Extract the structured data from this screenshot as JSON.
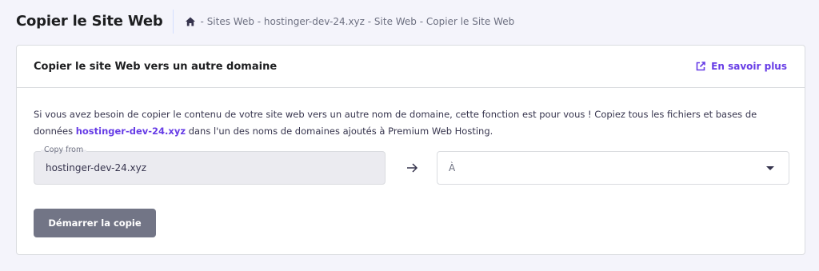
{
  "header": {
    "title": "Copier le Site Web",
    "breadcrumb": "- Sites Web - hostinger-dev-24.xyz - Site Web - Copier le Site Web"
  },
  "card": {
    "title": "Copier le site Web vers un autre domaine",
    "learn_more": "En savoir plus",
    "description_part1": "Si vous avez besoin de copier le contenu de votre site web vers un autre nom de domaine, cette fonction est pour vous ! Copiez tous les fichiers et bases de données ",
    "description_domain": "hostinger-dev-24.xyz",
    "description_part2": " dans l'un des noms de domaines ajoutés à Premium Web Hosting."
  },
  "form": {
    "copy_from_label": "Copy from",
    "copy_from_value": "hostinger-dev-24.xyz",
    "to_placeholder": "À",
    "start_button": "Démarrer la copie"
  },
  "colors": {
    "accent": "#673de6",
    "button_disabled": "#727586",
    "background": "#f4f4fb"
  },
  "icons": [
    "home-icon",
    "external-link-icon",
    "arrow-right-icon",
    "caret-down-icon"
  ]
}
